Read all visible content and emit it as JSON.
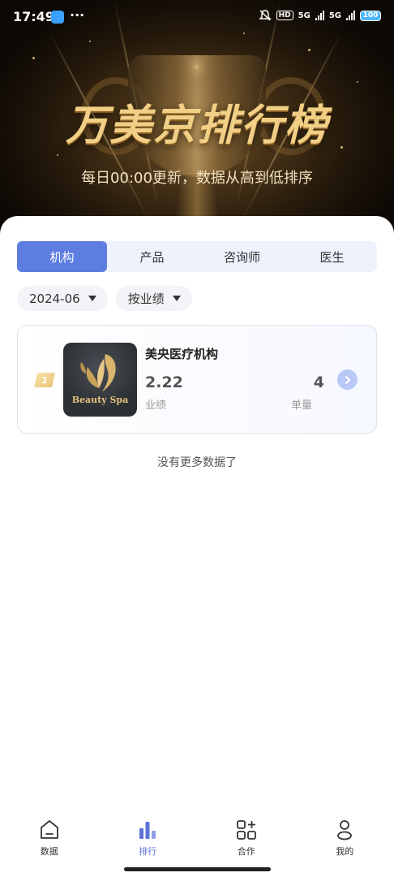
{
  "status_bar": {
    "time": "17:49",
    "network": "5G",
    "hd": "HD",
    "battery": "100",
    "more": "···"
  },
  "banner": {
    "title": "万美京排行榜",
    "subtitle": "每日00:00更新，数据从高到低排序"
  },
  "tabs": [
    {
      "label": "机构",
      "active": true
    },
    {
      "label": "产品",
      "active": false
    },
    {
      "label": "咨询师",
      "active": false
    },
    {
      "label": "医生",
      "active": false
    }
  ],
  "filters": {
    "month": "2024-06",
    "sort": "按业绩"
  },
  "ranking": [
    {
      "rank": "1",
      "name": "美央医疗机构",
      "performance": "2.22",
      "performance_label": "业绩",
      "orders": "4",
      "orders_label": "单量",
      "logo_text": "Beauty Spa"
    }
  ],
  "no_more_text": "没有更多数据了",
  "bottom_nav": [
    {
      "label": "数据",
      "icon": "home-icon",
      "active": false
    },
    {
      "label": "排行",
      "icon": "bar-chart-icon",
      "active": true
    },
    {
      "label": "合作",
      "icon": "grid-plus-icon",
      "active": false
    },
    {
      "label": "我的",
      "icon": "user-icon",
      "active": false
    }
  ],
  "colors": {
    "accent": "#5d7ee0",
    "tab_bg": "#eef2fc",
    "banner_gold": "#f1cf86",
    "nav_active": "#5b72d6"
  }
}
